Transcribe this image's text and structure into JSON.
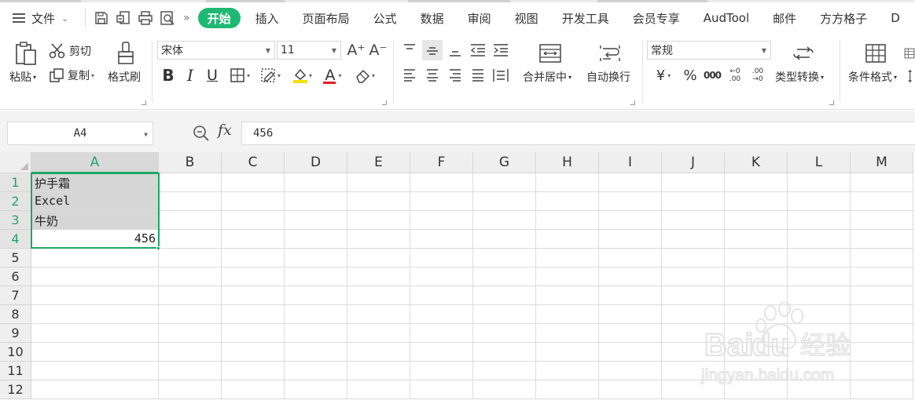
{
  "menubar": {
    "file_label": "文件",
    "tabs": [
      {
        "label": "开始",
        "active": true
      },
      {
        "label": "插入"
      },
      {
        "label": "页面布局"
      },
      {
        "label": "公式"
      },
      {
        "label": "数据"
      },
      {
        "label": "审阅"
      },
      {
        "label": "视图"
      },
      {
        "label": "开发工具"
      },
      {
        "label": "会员专享"
      },
      {
        "label": "AudTool"
      },
      {
        "label": "邮件"
      },
      {
        "label": "方方格子"
      },
      {
        "label": "D"
      }
    ],
    "quick_icons": [
      "save-icon",
      "export-icon",
      "print-icon",
      "print-preview-icon"
    ],
    "more_glyph": "»"
  },
  "ribbon": {
    "clipboard": {
      "paste_label": "粘贴",
      "cut_label": "剪切",
      "copy_label": "复制",
      "format_painter_label": "格式刷"
    },
    "font": {
      "font_name": "宋体",
      "font_size": "11",
      "bold_glyph": "B",
      "italic_glyph": "I",
      "underline_glyph": "U",
      "font_color_glyph": "A",
      "increase_glyph": "A⁺",
      "decrease_glyph": "A⁻"
    },
    "alignment": {
      "merge_label": "合并居中",
      "wrap_label": "自动换行"
    },
    "number": {
      "format": "常规",
      "currency_glyph": "¥",
      "percent_glyph": "%",
      "thousands_glyph": "000",
      "inc_decimal_glyph": "←0 .00",
      "dec_decimal_glyph": ".00 →0",
      "type_convert_label": "类型转换"
    },
    "styles": {
      "conditional_label": "条件格式"
    }
  },
  "formula_bar": {
    "cell_ref": "A4",
    "fx_label": "fx",
    "value": "456"
  },
  "sheet": {
    "columns": [
      "A",
      "B",
      "C",
      "D",
      "E",
      "F",
      "G",
      "H",
      "I",
      "J",
      "K",
      "L",
      "M"
    ],
    "active_column": "A",
    "rows": [
      "1",
      "2",
      "3",
      "4",
      "5",
      "6",
      "7",
      "8",
      "9",
      "10",
      "11",
      "12"
    ],
    "active_rows": [
      "1",
      "2",
      "3",
      "4"
    ],
    "cells": {
      "A1": "护手霜",
      "A2": "Excel",
      "A3": "牛奶",
      "A4": "456"
    }
  },
  "colors": {
    "accent": "#1fb873",
    "selection": "#1fa766",
    "header_bg": "#efefef",
    "shaded_cell": "#d6d6d6"
  }
}
